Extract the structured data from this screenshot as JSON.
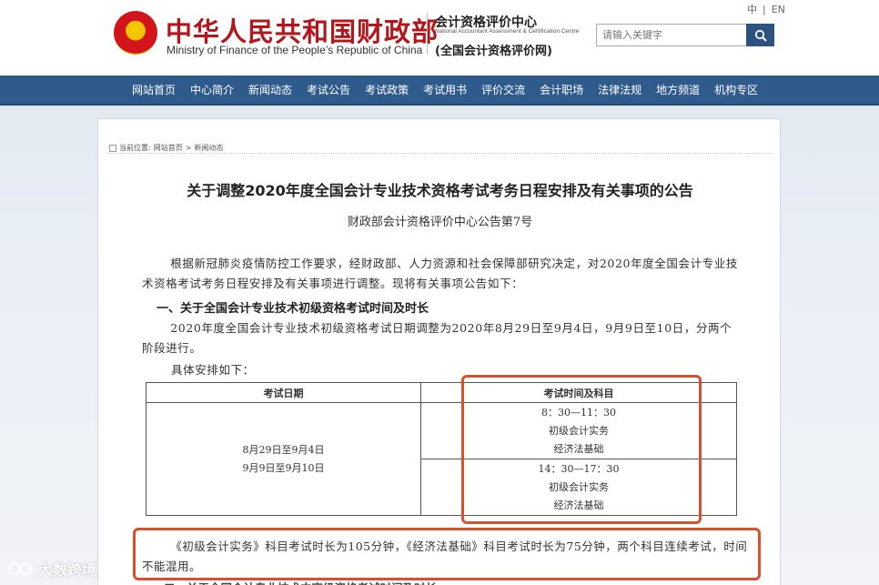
{
  "header": {
    "lang_cn": "中",
    "lang_sep": "|",
    "lang_en": "EN",
    "brand_cn": "中华人民共和国财政部",
    "brand_en": "Ministry of Finance of the People’s Republic of China",
    "center_cn": "会计资格评价中心",
    "center_en": "National Accountant Assessment & Certification Centre",
    "center_web": "(全国会计资格评价网)",
    "search_placeholder": "请输入关键字",
    "accent_color": "#b3171b"
  },
  "nav": {
    "items": [
      "网站首页",
      "中心简介",
      "新闻动态",
      "考试公告",
      "考试政策",
      "考试用书",
      "评价交流",
      "会计职场",
      "法律法规",
      "地方频道",
      "机构专区"
    ],
    "color": "#2f5a8c"
  },
  "breadcrumb": {
    "label": "当前位置:",
    "home": "网站首页",
    "sep": ">",
    "current": "新闻动态"
  },
  "article": {
    "title": "关于调整2020年度全国会计专业技术资格考试考务日程安排及有关事项的公告",
    "subtitle": "财政部会计资格评价中心公告第7号",
    "intro": "根据新冠肺炎疫情防控工作要求，经财政部、人力资源和社会保障部研究决定，对2020年度全国会计专业技术资格考试考务日程安排及有关事项进行调整。现将有关事项公告如下：",
    "section1_title": "一、关于全国会计专业技术初级资格考试时间及时长",
    "section1_p1": "2020年度全国会计专业技术初级资格考试日期调整为2020年8月29日至9月4日，9月9日至10日，分两个阶段进行。",
    "section1_p2": "具体安排如下：",
    "table": {
      "headers": [
        "考试日期",
        "考试时间及科目"
      ],
      "date_line1": "8月29日至9月4日",
      "date_line2": "9月9日至9月10日",
      "sessions": [
        {
          "time": "8：30—11：30",
          "subject1": "初级会计实务",
          "subject2": "经济法基础"
        },
        {
          "time": "14：30—17：30",
          "subject1": "初级会计实务",
          "subject2": "经济法基础"
        }
      ]
    },
    "note": "《初级会计实务》科目考试时长为105分钟，《经济法基础》科目考试时长为75分钟，两个科目连续考试，时间不能混用。",
    "next_heading_cut": "二、关于全国会计专业技术中高级资格考试时间及时长"
  },
  "watermark": {
    "text": "大数跨境"
  },
  "highlight_color": "#d9502c"
}
